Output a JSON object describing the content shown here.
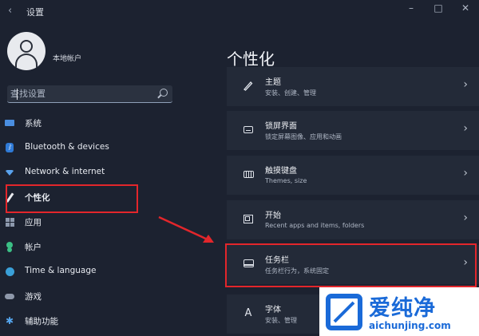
{
  "window": {
    "back_glyph": "‹",
    "title": "设置",
    "controls": {
      "minimize": "–",
      "maximize": "□",
      "close": "✕"
    }
  },
  "account": {
    "name": "本地帐户"
  },
  "search": {
    "placeholder": "查找设置"
  },
  "nav": {
    "items": [
      {
        "label": "系统",
        "icon": "monitor-icon"
      },
      {
        "label": "Bluetooth & devices",
        "icon": "bluetooth-icon"
      },
      {
        "label": "Network & internet",
        "icon": "wifi-icon"
      },
      {
        "label": "个性化",
        "icon": "pen-icon",
        "active": true
      },
      {
        "label": "应用",
        "icon": "apps-icon"
      },
      {
        "label": "帐户",
        "icon": "account-icon"
      },
      {
        "label": "Time & language",
        "icon": "globe-clock-icon"
      },
      {
        "label": "游戏",
        "icon": "gamepad-icon"
      },
      {
        "label": "辅助功能",
        "icon": "accessibility-icon"
      }
    ]
  },
  "main": {
    "title": "个性化",
    "rows": [
      {
        "title": "主题",
        "subtitle": "安装、创建、管理",
        "icon": "brush-icon"
      },
      {
        "title": "锁屏界面",
        "subtitle": "锁定屏幕图像、应用和动画",
        "icon": "lock-screen-icon"
      },
      {
        "title": "触摸键盘",
        "subtitle": "Themes, size",
        "icon": "keyboard-icon"
      },
      {
        "title": "开始",
        "subtitle": "Recent apps and items, folders",
        "icon": "start-menu-icon"
      },
      {
        "title": "任务栏",
        "subtitle": "任务栏行为，系统固定",
        "icon": "taskbar-icon"
      },
      {
        "title": "字体",
        "subtitle": "安装、管理",
        "icon": "font-icon"
      }
    ],
    "font_glyph": "A",
    "chevron": "›"
  },
  "colors": {
    "background": "#1c2230",
    "row_background": "#232a38",
    "highlight_red": "#e3262b",
    "accent_blue": "#2f7ad6"
  },
  "watermark": {
    "brand": "爱纯净",
    "url": "aichunjing.com"
  }
}
